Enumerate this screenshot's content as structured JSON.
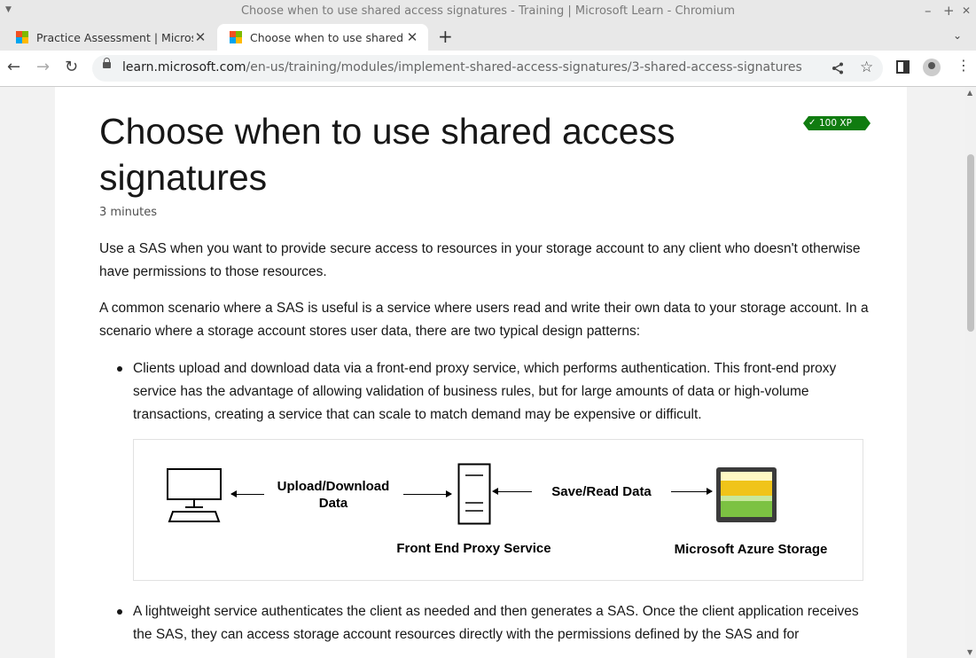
{
  "window": {
    "title": "Choose when to use shared access signatures - Training | Microsoft Learn - Chromium",
    "minimize_glyph": "–",
    "maximize_glyph": "+",
    "close_glyph": "✕"
  },
  "tabs": [
    {
      "label": "Practice Assessment | Microsoft Learn",
      "icon": "microsoft-logo-icon",
      "active": false
    },
    {
      "label": "Choose when to use shared access signatures",
      "icon": "microsoft-logo-icon",
      "active": true
    }
  ],
  "address_bar": {
    "host": "learn.microsoft.com",
    "path": "/en-us/training/modules/implement-shared-access-signatures/3-shared-access-signatures"
  },
  "article": {
    "title": "Choose when to use shared access signatures",
    "duration": "3 minutes",
    "xp_badge": "100 XP",
    "paragraphs": [
      "Use a SAS when you want to provide secure access to resources in your storage account to any client who doesn't otherwise have permissions to those resources.",
      "A common scenario where a SAS is useful is a service where users read and write their own data to your storage account. In a scenario where a storage account stores user data, there are two typical design patterns:"
    ],
    "bullets": [
      "Clients upload and download data via a front-end proxy service, which performs authentication. This front-end proxy service has the advantage of allowing validation of business rules, but for large amounts of data or high-volume transactions, creating a service that can scale to match demand may be expensive or difficult.",
      "A lightweight service authenticates the client as needed and then generates a SAS. Once the client application receives the SAS, they can access storage account resources directly with the permissions defined by the SAS and for"
    ]
  },
  "diagram": {
    "arrow_label_1": "Upload/Download Data",
    "arrow_label_2": "Save/Read Data",
    "node_label_proxy": "Front End Proxy Service",
    "node_label_storage": "Microsoft Azure Storage"
  },
  "colors": {
    "xp_badge": "#107c10",
    "ms_red": "#f25022",
    "ms_green": "#7fba00",
    "ms_blue": "#00a4ef",
    "ms_yellow": "#ffb900",
    "storage_yellow": "#f0c419",
    "storage_green": "#7cc242"
  }
}
